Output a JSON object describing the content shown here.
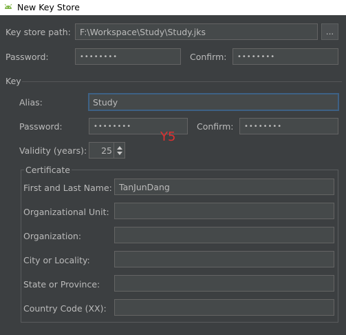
{
  "window": {
    "title": "New Key Store",
    "icon": "android-icon"
  },
  "keystore": {
    "path_label": "Key store path:",
    "path_value": "F:\\Workspace\\Study\\Study.jks",
    "browse_label": "...",
    "password_label": "Password:",
    "password_value": "••••••••",
    "confirm_label": "Confirm:",
    "confirm_value": "••••••••"
  },
  "key": {
    "section_label": "Key",
    "alias_label": "Alias:",
    "alias_value": "Study",
    "password_label": "Password:",
    "password_value": "••••••••",
    "confirm_label": "Confirm:",
    "confirm_value": "••••••••",
    "validity_label": "Validity (years):",
    "validity_value": "25",
    "annotation": "Y5"
  },
  "certificate": {
    "title": "Certificate",
    "fields": [
      {
        "label": "First and Last Name:",
        "value": "TanJunDang"
      },
      {
        "label": "Organizational Unit:",
        "value": ""
      },
      {
        "label": "Organization:",
        "value": ""
      },
      {
        "label": "City or Locality:",
        "value": ""
      },
      {
        "label": "State or Province:",
        "value": ""
      },
      {
        "label": "Country Code (XX):",
        "value": ""
      }
    ]
  },
  "colors": {
    "background": "#3c3f41",
    "field": "#45494a",
    "focus_border": "#3d6185",
    "text": "#bbbbbb",
    "annotation": "#e03030"
  }
}
